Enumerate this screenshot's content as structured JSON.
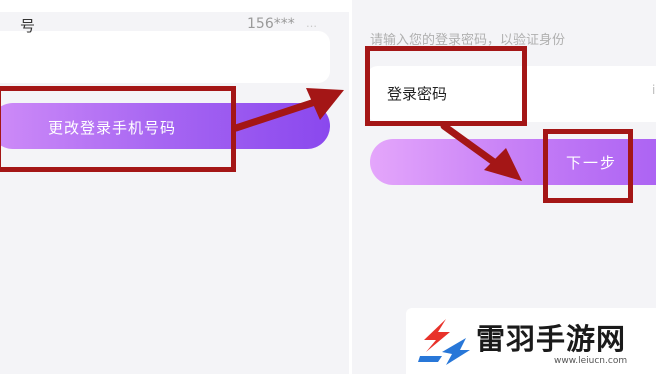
{
  "left_screen": {
    "phone_label": "号",
    "phone_value": "156***",
    "phone_extra": "…",
    "change_button": "更改登录手机号码"
  },
  "right_screen": {
    "hint": "请输入您的登录密码，以验证身份",
    "password_label": "登录密码",
    "password_extra": "i",
    "next_button": "下一步"
  },
  "watermark": {
    "name": "雷羽手游网",
    "domain": "www.leiucn.com"
  },
  "colors": {
    "annotation": "#a41616",
    "brand_purple": "#a766f2",
    "logo_red": "#e8322a",
    "logo_blue": "#2877d8"
  }
}
